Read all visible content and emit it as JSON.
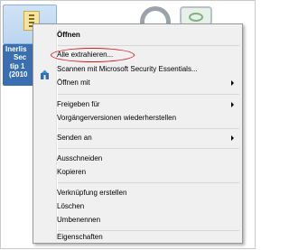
{
  "desktop": {
    "file_label_lines": [
      "Inerlis",
      "Sec",
      "tip 1",
      "(2010"
    ]
  },
  "context_menu": {
    "items": [
      {
        "label": "Öffnen",
        "bold": true,
        "submenu": false
      },
      {
        "label": "Alle extrahieren...",
        "bold": false,
        "submenu": false,
        "highlighted": true
      },
      {
        "label": "Scannen mit Microsoft Security Essentials...",
        "bold": false,
        "submenu": false,
        "icon": "microsoft-security-essentials-icon"
      },
      {
        "label": "Öffnen mit",
        "bold": false,
        "submenu": true
      },
      {
        "label": "Freigeben für",
        "bold": false,
        "submenu": true
      },
      {
        "label": "Vorgängerversionen wiederherstellen",
        "bold": false,
        "submenu": false
      },
      {
        "label": "Senden an",
        "bold": false,
        "submenu": true
      },
      {
        "label": "Ausschneiden",
        "bold": false,
        "submenu": false
      },
      {
        "label": "Kopieren",
        "bold": false,
        "submenu": false
      },
      {
        "label": "Verknüpfung erstellen",
        "bold": false,
        "submenu": false
      },
      {
        "label": "Löschen",
        "bold": false,
        "submenu": false
      },
      {
        "label": "Umbenennen",
        "bold": false,
        "submenu": false
      },
      {
        "label": "Eigenschaften",
        "bold": false,
        "submenu": false
      }
    ]
  },
  "colors": {
    "menu_background": "#f0f0f0",
    "menu_border": "#979797",
    "highlight_circle": "#d01f1f",
    "desktop_label_bg": "#3a6fb1"
  }
}
